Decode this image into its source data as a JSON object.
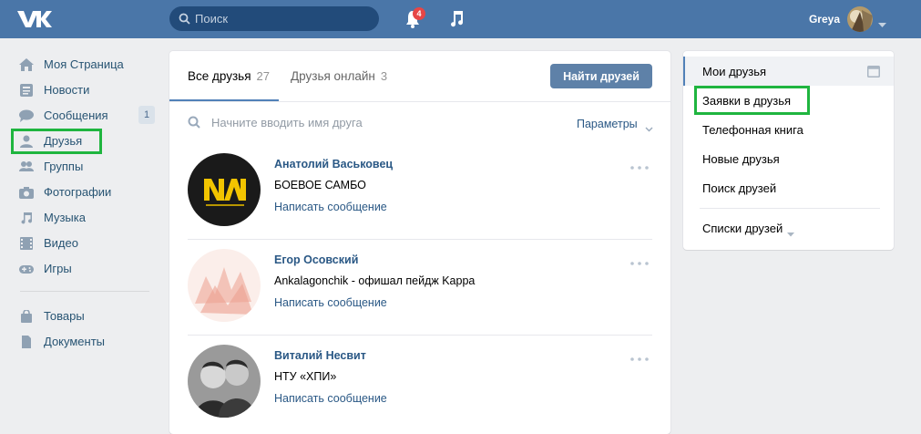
{
  "header": {
    "logo_icon": "vk-logo-icon",
    "search_placeholder": "Поиск",
    "notifications_count": "4",
    "username": "Greya",
    "accent_color": "#4a76a8"
  },
  "left_menu": {
    "items": [
      {
        "label": "Моя Страница",
        "icon": "home-icon"
      },
      {
        "label": "Новости",
        "icon": "news-icon"
      },
      {
        "label": "Сообщения",
        "icon": "messages-icon",
        "count": "1"
      },
      {
        "label": "Друзья",
        "icon": "friend-icon"
      },
      {
        "label": "Группы",
        "icon": "groups-icon"
      },
      {
        "label": "Фотографии",
        "icon": "camera-icon"
      },
      {
        "label": "Музыка",
        "icon": "music-icon"
      },
      {
        "label": "Видео",
        "icon": "video-icon"
      },
      {
        "label": "Игры",
        "icon": "gamepad-icon"
      }
    ],
    "extra_items": [
      {
        "label": "Товары",
        "icon": "bag-icon"
      },
      {
        "label": "Документы",
        "icon": "document-icon"
      }
    ]
  },
  "main": {
    "tabs": [
      {
        "label": "Все друзья",
        "count": "27"
      },
      {
        "label": "Друзья онлайн",
        "count": "3"
      }
    ],
    "find_button": "Найти друзей",
    "search_placeholder": "Начните вводить имя друга",
    "params_label": "Параметры",
    "friends": [
      {
        "name": "Анатолий Васьковец",
        "info": "БОЕВОЕ САМБО",
        "message": "Написать сообщение"
      },
      {
        "name": "Егор Осовский",
        "info": "Ankalagonchik - офишал пейдж Kappa",
        "message": "Написать сообщение"
      },
      {
        "name": "Виталий Несвит",
        "info": "НТУ «ХПИ»",
        "message": "Написать сообщение"
      }
    ]
  },
  "right_menu": {
    "items": [
      "Мои друзья",
      "Заявки в друзья",
      "Телефонная книга",
      "Новые друзья",
      "Поиск друзей"
    ],
    "lists_label": "Списки друзей"
  },
  "colors": {
    "highlight_green": "#1fb53f",
    "link_blue": "#2a5885"
  }
}
